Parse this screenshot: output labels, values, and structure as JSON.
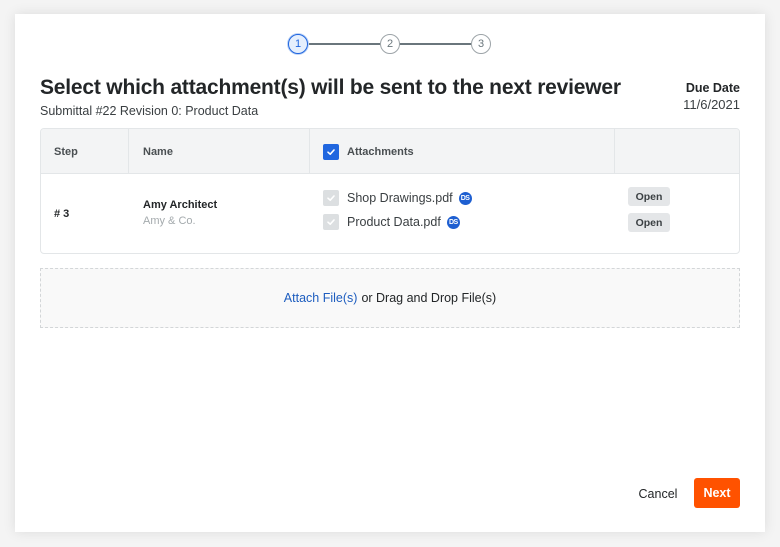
{
  "stepper": {
    "steps": [
      {
        "label": "1",
        "state": "active"
      },
      {
        "label": "2",
        "state": "pending"
      },
      {
        "label": "3",
        "state": "pending"
      }
    ]
  },
  "header": {
    "title": "Select which attachment(s) will be sent to the next reviewer",
    "subtitle": "Submittal #22 Revision 0: Product Data",
    "due_date_label": "Due Date",
    "due_date_value": "11/6/2021"
  },
  "table": {
    "columns": {
      "step": "Step",
      "name": "Name",
      "attachments": "Attachments",
      "actions": ""
    },
    "select_all_checked": true,
    "rows": [
      {
        "step": "# 3",
        "name": "Amy Architect",
        "company": "Amy & Co.",
        "attachments": [
          {
            "filename": "Shop Drawings.pdf",
            "checked": true,
            "disabled": true,
            "badge_icon": "docusign-icon",
            "action_label": "Open"
          },
          {
            "filename": "Product Data.pdf",
            "checked": true,
            "disabled": true,
            "badge_icon": "docusign-icon",
            "action_label": "Open"
          }
        ]
      }
    ]
  },
  "dropzone": {
    "link_label": "Attach File(s)",
    "text": "or Drag and Drop File(s)"
  },
  "footer": {
    "cancel_label": "Cancel",
    "next_label": "Next"
  },
  "colors": {
    "primary_blue": "#2066df",
    "next_button": "#ff5200",
    "link": "#1d5dbf"
  }
}
